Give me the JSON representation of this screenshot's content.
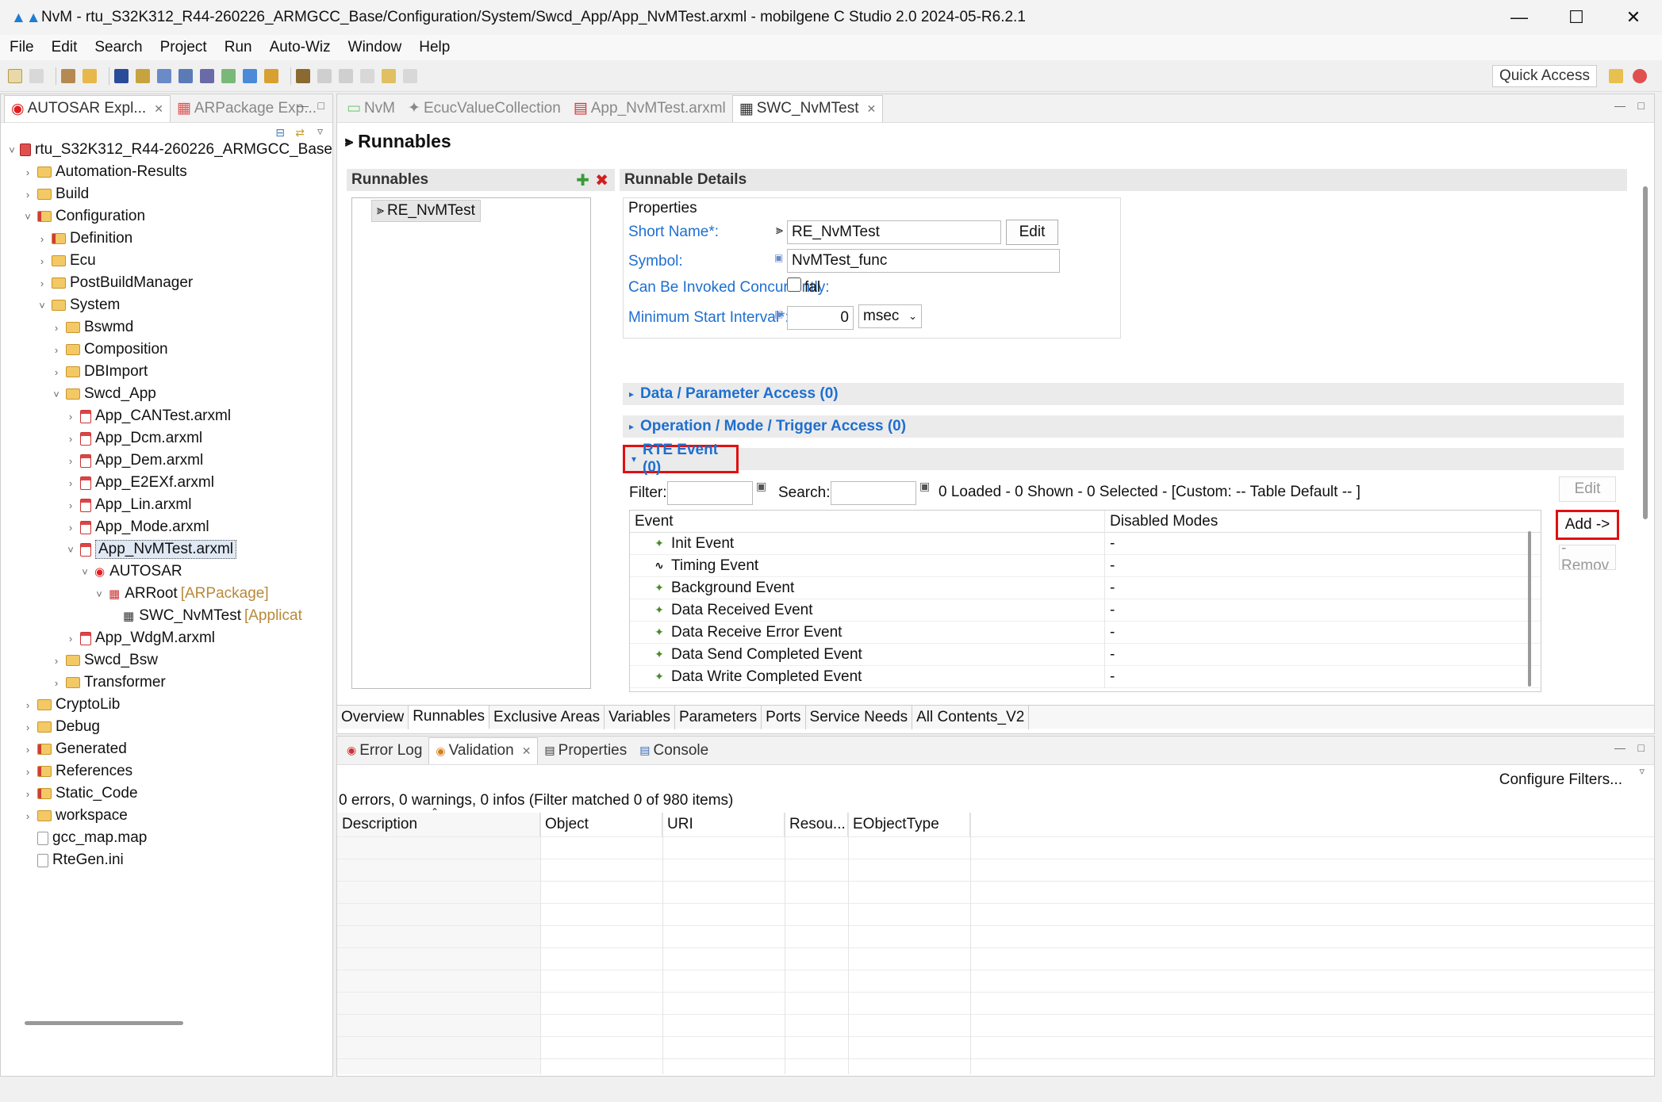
{
  "window": {
    "title": "NvM - rtu_S32K312_R44-260226_ARMGCC_Base/Configuration/System/Swcd_App/App_NvMTest.arxml - mobilgene C Studio 2.0 2024-05-R6.2.1"
  },
  "menu": [
    "File",
    "Edit",
    "Search",
    "Project",
    "Run",
    "Auto-Wiz",
    "Window",
    "Help"
  ],
  "toolbar": {
    "quick_access": "Quick Access"
  },
  "left": {
    "tabs": [
      {
        "label": "AUTOSAR Expl..."
      },
      {
        "label": "ARPackage Exp..."
      }
    ],
    "tree": [
      {
        "label": "rtu_S32K312_R44-260226_ARMGCC_Base",
        "depth": 0,
        "tw": "v",
        "icon": "proj"
      },
      {
        "label": "Automation-Results",
        "depth": 1,
        "tw": ">",
        "icon": "folder"
      },
      {
        "label": "Build",
        "depth": 1,
        "tw": ">",
        "icon": "folder"
      },
      {
        "label": "Configuration",
        "depth": 1,
        "tw": "v",
        "icon": "folderred"
      },
      {
        "label": "Definition",
        "depth": 2,
        "tw": ">",
        "icon": "folderred"
      },
      {
        "label": "Ecu",
        "depth": 2,
        "tw": ">",
        "icon": "folder"
      },
      {
        "label": "PostBuildManager",
        "depth": 2,
        "tw": ">",
        "icon": "folder"
      },
      {
        "label": "System",
        "depth": 2,
        "tw": "v",
        "icon": "folder"
      },
      {
        "label": "Bswmd",
        "depth": 3,
        "tw": ">",
        "icon": "folder"
      },
      {
        "label": "Composition",
        "depth": 3,
        "tw": ">",
        "icon": "folder"
      },
      {
        "label": "DBImport",
        "depth": 3,
        "tw": ">",
        "icon": "folder"
      },
      {
        "label": "Swcd_App",
        "depth": 3,
        "tw": "v",
        "icon": "folder"
      },
      {
        "label": "App_CANTest.arxml",
        "depth": 4,
        "tw": ">",
        "icon": "filered"
      },
      {
        "label": "App_Dcm.arxml",
        "depth": 4,
        "tw": ">",
        "icon": "filered"
      },
      {
        "label": "App_Dem.arxml",
        "depth": 4,
        "tw": ">",
        "icon": "filered"
      },
      {
        "label": "App_E2EXf.arxml",
        "depth": 4,
        "tw": ">",
        "icon": "filered"
      },
      {
        "label": "App_Lin.arxml",
        "depth": 4,
        "tw": ">",
        "icon": "filered"
      },
      {
        "label": "App_Mode.arxml",
        "depth": 4,
        "tw": ">",
        "icon": "filered"
      },
      {
        "label": "App_NvMTest.arxml",
        "depth": 4,
        "tw": "v",
        "icon": "filered",
        "selected": true
      },
      {
        "label": "AUTOSAR",
        "depth": 5,
        "tw": "v",
        "icon": "autosar"
      },
      {
        "label": "ARRoot",
        "suffix": "[ARPackage]",
        "depth": 6,
        "tw": "v",
        "icon": "pkg"
      },
      {
        "label": "SWC_NvMTest",
        "suffix": "[Applicat",
        "depth": 7,
        "tw": "",
        "icon": "swc"
      },
      {
        "label": "App_WdgM.arxml",
        "depth": 4,
        "tw": ">",
        "icon": "filered"
      },
      {
        "label": "Swcd_Bsw",
        "depth": 3,
        "tw": ">",
        "icon": "folder"
      },
      {
        "label": "Transformer",
        "depth": 3,
        "tw": ">",
        "icon": "folder"
      },
      {
        "label": "CryptoLib",
        "depth": 1,
        "tw": ">",
        "icon": "folder"
      },
      {
        "label": "Debug",
        "depth": 1,
        "tw": ">",
        "icon": "folder"
      },
      {
        "label": "Generated",
        "depth": 1,
        "tw": ">",
        "icon": "folderred"
      },
      {
        "label": "References",
        "depth": 1,
        "tw": ">",
        "icon": "folderred"
      },
      {
        "label": "Static_Code",
        "depth": 1,
        "tw": ">",
        "icon": "folderred"
      },
      {
        "label": "workspace",
        "depth": 1,
        "tw": ">",
        "icon": "folder"
      },
      {
        "label": "gcc_map.map",
        "depth": 1,
        "tw": "",
        "icon": "file"
      },
      {
        "label": "RteGen.ini",
        "depth": 1,
        "tw": "",
        "icon": "file"
      }
    ]
  },
  "editor": {
    "tabs": [
      {
        "label": "NvM",
        "active": false
      },
      {
        "label": "EcucValueCollection",
        "active": false
      },
      {
        "label": "App_NvMTest.arxml",
        "active": false
      },
      {
        "label": "SWC_NvMTest",
        "active": true
      }
    ],
    "page_title": "Runnables",
    "runnables": {
      "header": "Runnables",
      "items": [
        "RE_NvMTest"
      ]
    },
    "details": {
      "header": "Runnable Details",
      "properties_label": "Properties",
      "short_name_label": "Short Name*:",
      "short_name_value": "RE_NvMTest",
      "edit_label": "Edit",
      "symbol_label": "Symbol:",
      "symbol_value": "NvMTest_func",
      "concurrent_label": "Can Be Invoked Concurrently:",
      "concurrent_value": "fal",
      "min_interval_label": "Minimum Start Interval*:",
      "min_interval_value": "0",
      "min_interval_unit": "msec"
    },
    "sections": {
      "data_access": "Data / Parameter Access (0)",
      "operation_access": "Operation / Mode / Trigger Access (0)",
      "rte_event": "RTE Event (0)"
    },
    "rte": {
      "filter_label": "Filter:",
      "search_label": "Search:",
      "status": "0 Loaded - 0 Shown - 0 Selected -  [Custom: -- Table Default -- ]",
      "col_event": "Event",
      "col_modes": "Disabled Modes",
      "rows": [
        {
          "event": "Init Event",
          "modes": "-"
        },
        {
          "event": "Timing Event",
          "modes": "-"
        },
        {
          "event": "Background Event",
          "modes": "-"
        },
        {
          "event": "Data Received Event",
          "modes": "-"
        },
        {
          "event": "Data Receive Error Event",
          "modes": "-"
        },
        {
          "event": "Data Send Completed Event",
          "modes": "-"
        },
        {
          "event": "Data Write Completed Event",
          "modes": "-"
        }
      ],
      "btn_edit": "Edit",
      "btn_add": "Add ->",
      "btn_remove": "- Remov"
    },
    "bottom_tabs": [
      "Overview",
      "Runnables",
      "Exclusive Areas",
      "Variables",
      "Parameters",
      "Ports",
      "Service Needs",
      "All Contents_V2"
    ]
  },
  "lower": {
    "tabs": [
      {
        "label": "Error Log",
        "active": false
      },
      {
        "label": "Validation",
        "active": true
      },
      {
        "label": "Properties",
        "active": false
      },
      {
        "label": "Console",
        "active": false
      }
    ],
    "configure_filters": "Configure Filters...",
    "summary": "0 errors, 0 warnings, 0 infos (Filter matched 0 of 980 items)",
    "columns": [
      "Description",
      "Object",
      "URI",
      "Resou...",
      "EObjectType"
    ]
  },
  "colors": {
    "accent": "#1e6fd0",
    "highlight": "#e01010"
  }
}
